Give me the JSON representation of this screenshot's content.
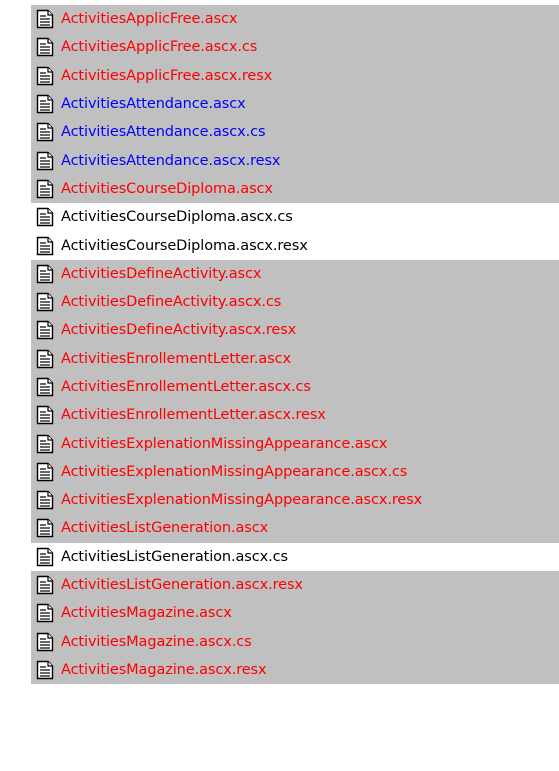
{
  "colors": {
    "red": "#ff0000",
    "blue": "#0000ff",
    "black": "#000000",
    "highlight_bg": "#c0c0c0",
    "normal_bg": "#ffffff"
  },
  "icon": "text-file-icon",
  "files": [
    {
      "name": "ActivitiesApplicFree.ascx",
      "color": "red",
      "highlighted": true
    },
    {
      "name": "ActivitiesApplicFree.ascx.cs",
      "color": "red",
      "highlighted": true
    },
    {
      "name": "ActivitiesApplicFree.ascx.resx",
      "color": "red",
      "highlighted": true
    },
    {
      "name": "ActivitiesAttendance.ascx",
      "color": "blue",
      "highlighted": true
    },
    {
      "name": "ActivitiesAttendance.ascx.cs",
      "color": "blue",
      "highlighted": true
    },
    {
      "name": "ActivitiesAttendance.ascx.resx",
      "color": "blue",
      "highlighted": true
    },
    {
      "name": "ActivitiesCourseDiploma.ascx",
      "color": "red",
      "highlighted": true
    },
    {
      "name": "ActivitiesCourseDiploma.ascx.cs",
      "color": "black",
      "highlighted": false
    },
    {
      "name": "ActivitiesCourseDiploma.ascx.resx",
      "color": "black",
      "highlighted": false
    },
    {
      "name": "ActivitiesDefineActivity.ascx",
      "color": "red",
      "highlighted": true
    },
    {
      "name": "ActivitiesDefineActivity.ascx.cs",
      "color": "red",
      "highlighted": true
    },
    {
      "name": "ActivitiesDefineActivity.ascx.resx",
      "color": "red",
      "highlighted": true
    },
    {
      "name": "ActivitiesEnrollementLetter.ascx",
      "color": "red",
      "highlighted": true
    },
    {
      "name": "ActivitiesEnrollementLetter.ascx.cs",
      "color": "red",
      "highlighted": true
    },
    {
      "name": "ActivitiesEnrollementLetter.ascx.resx",
      "color": "red",
      "highlighted": true
    },
    {
      "name": "ActivitiesExplenationMissingAppearance.ascx",
      "color": "red",
      "highlighted": true
    },
    {
      "name": "ActivitiesExplenationMissingAppearance.ascx.cs",
      "color": "red",
      "highlighted": true
    },
    {
      "name": "ActivitiesExplenationMissingAppearance.ascx.resx",
      "color": "red",
      "highlighted": true
    },
    {
      "name": "ActivitiesListGeneration.ascx",
      "color": "red",
      "highlighted": true
    },
    {
      "name": "ActivitiesListGeneration.ascx.cs",
      "color": "black",
      "highlighted": false
    },
    {
      "name": "ActivitiesListGeneration.ascx.resx",
      "color": "red",
      "highlighted": true
    },
    {
      "name": "ActivitiesMagazine.ascx",
      "color": "red",
      "highlighted": true
    },
    {
      "name": "ActivitiesMagazine.ascx.cs",
      "color": "red",
      "highlighted": true
    },
    {
      "name": "ActivitiesMagazine.ascx.resx",
      "color": "red",
      "highlighted": true
    }
  ]
}
